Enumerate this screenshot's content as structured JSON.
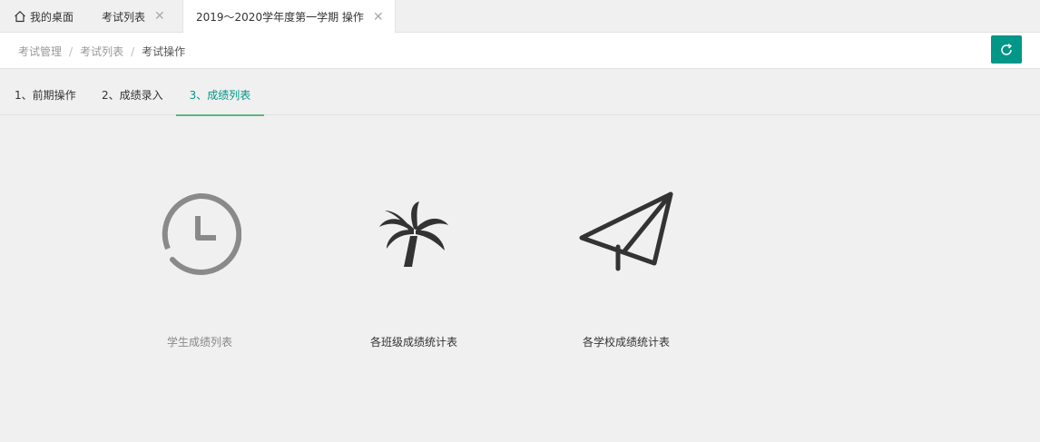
{
  "tabs": [
    {
      "label": "我的桌面",
      "icon": "home-icon",
      "closable": false
    },
    {
      "label": "考试列表",
      "closable": true
    },
    {
      "label": "2019～2020学年度第一学期 操作",
      "closable": true,
      "active": true
    }
  ],
  "close_glyph": "✕",
  "breadcrumb": {
    "items": [
      "考试管理",
      "考试列表",
      "考试操作"
    ],
    "separator": "/"
  },
  "refresh_icon": "refresh-icon",
  "accent_color": "#009688",
  "steps": [
    {
      "label": "1、前期操作"
    },
    {
      "label": "2、成绩录入"
    },
    {
      "label": "3、成绩列表",
      "active": true
    }
  ],
  "cards": [
    {
      "label": "学生成绩列表",
      "icon": "clock-icon"
    },
    {
      "label": "各班级成绩统计表",
      "icon": "palm-tree-icon"
    },
    {
      "label": "各学校成绩统计表",
      "icon": "paper-plane-icon"
    }
  ]
}
